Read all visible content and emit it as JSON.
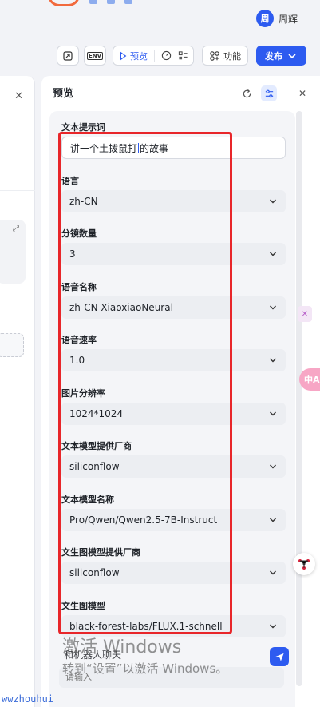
{
  "user": {
    "avatar_letter": "周",
    "name": "周辉"
  },
  "toolbar": {
    "preview_label": "预览",
    "func_label": "功能",
    "publish_label": "发布",
    "env_label": "ENV"
  },
  "preview": {
    "title": "预览",
    "fields": [
      {
        "label": "文本提示词",
        "value": "讲一个土拨鼠打",
        "value_after_cursor": "的故事",
        "kind": "text"
      },
      {
        "label": "语言",
        "value": "zh-CN",
        "kind": "select"
      },
      {
        "label": "分镜数量",
        "value": "3",
        "kind": "select"
      },
      {
        "label": "语音名称",
        "value": "zh-CN-XiaoxiaoNeural",
        "kind": "select"
      },
      {
        "label": "语音速率",
        "value": "1.0",
        "kind": "select"
      },
      {
        "label": "图片分辨率",
        "value": "1024*1024",
        "kind": "select"
      },
      {
        "label": "文本模型提供厂商",
        "value": "siliconflow",
        "kind": "select"
      },
      {
        "label": "文本模型名称",
        "value": "Pro/Qwen/Qwen2.5-7B-Instruct",
        "kind": "select"
      },
      {
        "label": "文生图模型提供厂商",
        "value": "siliconflow",
        "kind": "select"
      },
      {
        "label": "文生图模型",
        "value": "black-forest-labs/FLUX.1-schnell",
        "kind": "select"
      }
    ]
  },
  "chat": {
    "label": "和机器人聊天",
    "placeholder": "请输入"
  },
  "watermark": {
    "line1": "激活 Windows",
    "line2": "转到“设置”以激活 Windows。"
  },
  "site_text": "wwzhouhui",
  "float2_text": "中A",
  "colors": {
    "accent": "#2d5bf0",
    "highlight_box": "#e8262a"
  }
}
